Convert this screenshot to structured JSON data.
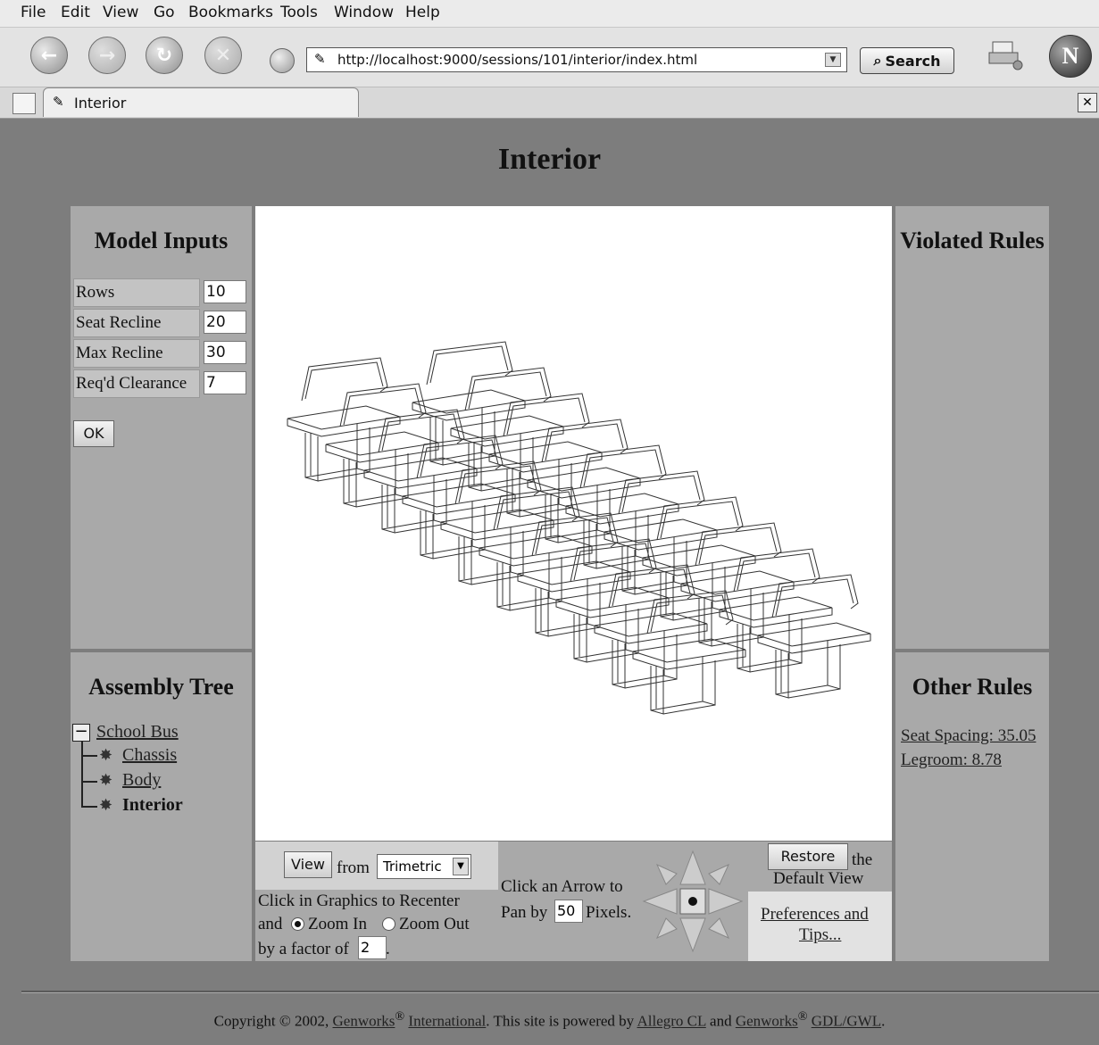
{
  "browser": {
    "menu": [
      "File",
      "Edit",
      "View",
      "Go",
      "Bookmarks",
      "Tools",
      "Window",
      "Help"
    ],
    "url": "http://localhost:9000/sessions/101/interior/index.html",
    "search_label": "Search",
    "tab_label": "Interior"
  },
  "page": {
    "title": "Interior"
  },
  "model_inputs": {
    "title": "Model Inputs",
    "fields": [
      {
        "label": "Rows",
        "value": "10"
      },
      {
        "label": "Seat Recline",
        "value": "20"
      },
      {
        "label": "Max Recline",
        "value": "30"
      },
      {
        "label": "Req'd Clearance",
        "value": "7"
      }
    ],
    "ok_label": "OK"
  },
  "violated_rules": {
    "title": "Violated Rules"
  },
  "assembly_tree": {
    "title": "Assembly Tree",
    "root": "School Bus",
    "children": [
      "Chassis",
      "Body",
      "Interior"
    ]
  },
  "other_rules": {
    "title": "Other Rules",
    "items": [
      "Seat Spacing: 35.05",
      "Legroom: 8.78"
    ]
  },
  "view_controls": {
    "view_button": "View",
    "from_label": "from",
    "view_option": "Trimetric",
    "recenter_text": "Click in Graphics to Recenter",
    "and_label": "and",
    "zoom_in": "Zoom In",
    "zoom_out": "Zoom Out",
    "factor_label": "by a factor of",
    "factor_value": "2",
    "pan_text1": "Click an Arrow to",
    "pan_label": "Pan by",
    "pan_value": "50",
    "pixels_label": "Pixels.",
    "restore_button": "Restore",
    "the_label": "the",
    "default_view": "Default View",
    "prefs_link1": "Preferences and",
    "prefs_link2": "Tips..."
  },
  "footer": {
    "copyright": "Copyright © 2002,",
    "genworks": "Genworks",
    "international": "International",
    "powered": ". This site is powered by",
    "allegro": "Allegro CL",
    "and": "and",
    "genworks2": "Genworks",
    "gdl": "GDL/GWL",
    "end": "."
  }
}
